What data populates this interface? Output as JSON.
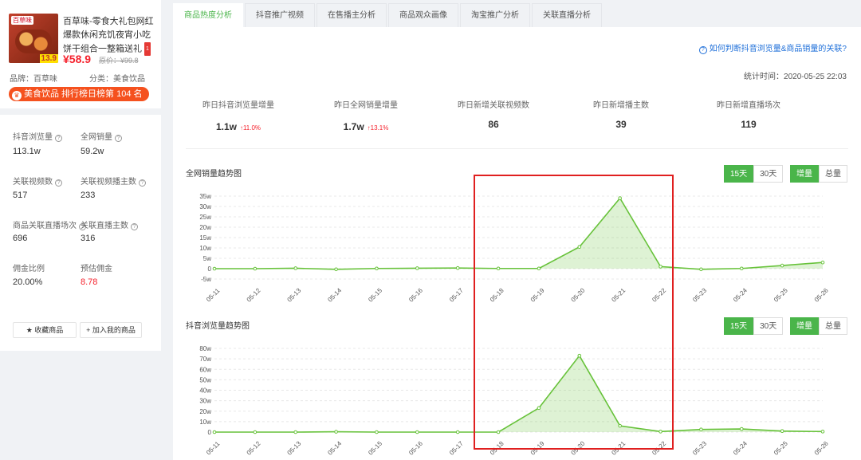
{
  "product": {
    "shop_logo": "百草味",
    "price_badge": "13.9",
    "title": "百草味-零食大礼包网红爆款休闲充饥夜宵小吃饼干组合一整箱送礼",
    "title_tag": "1",
    "price": "¥58.9",
    "original_price": "原价：¥99.8",
    "brand": "品牌：百草味",
    "category": "分类：美食饮品",
    "rank": "美食饮品 排行榜日榜第 104 名"
  },
  "stats": [
    {
      "label": "抖音浏览量",
      "value": "113.1w",
      "help": true
    },
    {
      "label": "全网销量",
      "value": "59.2w",
      "help": true
    },
    {
      "label": "关联视频数",
      "value": "517",
      "help": true
    },
    {
      "label": "关联视频播主数",
      "value": "233",
      "help": true
    },
    {
      "label": "商品关联直播场次",
      "value": "696",
      "help": true
    },
    {
      "label": "关联直播主数",
      "value": "316",
      "help": true
    },
    {
      "label": "佣金比例",
      "value": "20.00%",
      "help": false
    },
    {
      "label": "预估佣金",
      "value": "8.78",
      "help": false,
      "color": "#f5222d"
    }
  ],
  "actions": {
    "favorite": "★ 收藏商品",
    "add": "+ 加入我的商品"
  },
  "tabs": [
    "商品热度分析",
    "抖音推广视频",
    "在售播主分析",
    "商品观众画像",
    "淘宝推广分析",
    "关联直播分析"
  ],
  "help_link": "如何判断抖音浏览量&商品销量的关联?",
  "stat_time": "统计时间：2020-05-25 22:03",
  "kpis": [
    {
      "label": "昨日抖音浏览量增量",
      "value": "1.1w",
      "change": "↑11.0%"
    },
    {
      "label": "昨日全网销量增量",
      "value": "1.7w",
      "change": "↑13.1%"
    },
    {
      "label": "昨日新增关联视频数",
      "value": "86",
      "change": ""
    },
    {
      "label": "昨日新增播主数",
      "value": "39",
      "change": ""
    },
    {
      "label": "昨日新增直播场次",
      "value": "119",
      "change": ""
    }
  ],
  "range_options": [
    "15天",
    "30天"
  ],
  "mode_options": [
    "增量",
    "总量"
  ],
  "colors": {
    "accent": "#4ab54a",
    "highlight": "#e02020",
    "line": "#67c23a"
  },
  "chart_data": [
    {
      "type": "area",
      "title": "全网销量趋势图",
      "x": [
        "05-11",
        "05-12",
        "05-13",
        "05-14",
        "05-15",
        "05-16",
        "05-17",
        "05-18",
        "05-19",
        "05-20",
        "05-21",
        "05-22",
        "05-23",
        "05-24",
        "05-25",
        "05-26"
      ],
      "values": [
        0,
        0,
        0.2,
        -0.3,
        0.1,
        0.2,
        0.3,
        0.1,
        0.1,
        10.5,
        34,
        1,
        -0.3,
        0.1,
        1.5,
        3
      ],
      "yticks": [
        "35w",
        "30w",
        "25w",
        "20w",
        "15w",
        "10w",
        "5w",
        "0",
        "-5w"
      ],
      "ylim": [
        -5,
        35
      ]
    },
    {
      "type": "area",
      "title": "抖音浏览量趋势图",
      "x": [
        "05-11",
        "05-12",
        "05-13",
        "05-14",
        "05-15",
        "05-16",
        "05-17",
        "05-18",
        "05-19",
        "05-20",
        "05-21",
        "05-22",
        "05-23",
        "05-24",
        "05-25",
        "05-26"
      ],
      "values": [
        0,
        0,
        0,
        0.3,
        0,
        0,
        0,
        0,
        23,
        73,
        6,
        0.5,
        2.5,
        3,
        1,
        0.5
      ],
      "yticks": [
        "80w",
        "70w",
        "60w",
        "50w",
        "40w",
        "30w",
        "20w",
        "10w",
        "0"
      ],
      "ylim": [
        0,
        80
      ]
    }
  ]
}
